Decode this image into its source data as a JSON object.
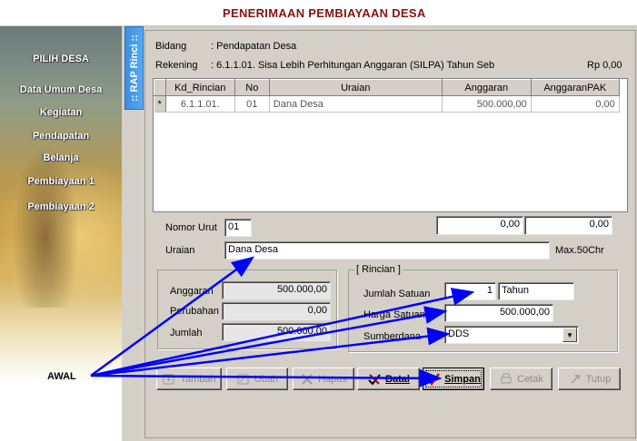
{
  "window": {
    "title": "PENERIMAAN PEMBIAYAAN DESA"
  },
  "sidebar": {
    "tab_label": ":: RAP Rinci ::",
    "items": [
      {
        "label": "PILIH DESA"
      },
      {
        "label": "Data Umum Desa"
      },
      {
        "label": "Kegiatan"
      },
      {
        "label": "Pendapatan"
      },
      {
        "label": "Belanja"
      },
      {
        "label": "Pembiayaan 1"
      },
      {
        "label": "Pembiayaan 2"
      }
    ]
  },
  "header": {
    "bidang_label": "Bidang",
    "bidang_value": ":  Pendapatan Desa",
    "rekening_label": "Rekening",
    "rekening_value": ":  6.1.1.01.  Sisa Lebih Perhitungan Anggaran  (SILPA) Tahun Seb",
    "rekening_total": "Rp 0,00"
  },
  "grid": {
    "columns": [
      "Kd_Rincian",
      "No",
      "Uraian",
      "Anggaran",
      "AnggaranPAK"
    ],
    "rows": [
      {
        "marker": "*",
        "kd_rincian": "6.1.1.01.",
        "no": "01",
        "uraian": "Dana Desa",
        "anggaran": "500.000,00",
        "anggaran_pak": "0,00"
      }
    ]
  },
  "totals": {
    "anggaran": "0,00",
    "anggaran_pak": "0,00"
  },
  "form": {
    "nomor_urut_label": "Nomor Urut",
    "nomor_urut": "01",
    "uraian_label": "Uraian",
    "uraian": "Dana Desa",
    "uraian_hint": "Max.50Chr"
  },
  "summary": {
    "anggaran_label": "Anggaran",
    "anggaran": "500.000,00",
    "perubahan_label": "Perubahan",
    "perubahan": "0,00",
    "jumlah_label": "Jumlah",
    "jumlah": "500.000,00"
  },
  "rincian": {
    "legend": "[ Rincian ]",
    "jumlah_satuan_label": "Jumlah Satuan",
    "jumlah_satuan": "1",
    "satuan": "Tahun",
    "harga_satuan_label": "Harga Satuan",
    "harga_satuan": "500.000,00",
    "sumberdana_label": "Sumberdana",
    "sumberdana": "DDS"
  },
  "buttons": {
    "tambah": "Tambah",
    "ubah": "Ubah",
    "hapus": "Hapus",
    "batal": "Batal",
    "simpan": "Simpan",
    "cetak": "Cetak",
    "tutup": "Tutup"
  },
  "annotation": {
    "label": "AWAL",
    "arrow_color": "#0000ff"
  },
  "colors": {
    "title": "#8b1010",
    "tab": "#3a8fe0",
    "annotation_arrow": "#0000ff"
  }
}
